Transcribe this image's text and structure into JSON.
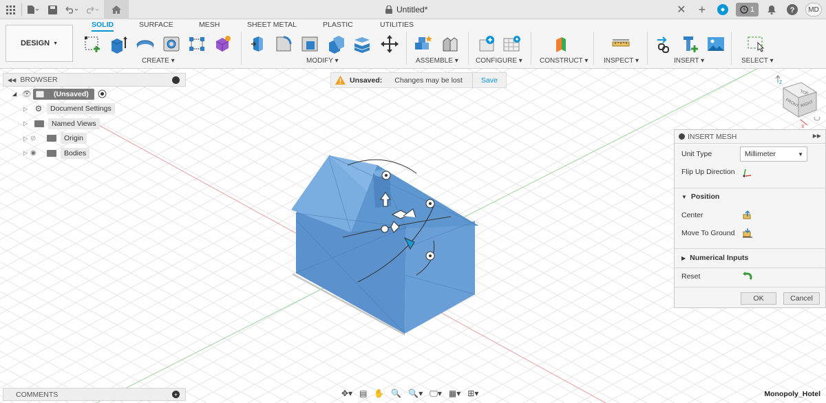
{
  "titlebar": {
    "doc_title": "Untitled*",
    "jobs_count": "1",
    "user_initials": "MD"
  },
  "toolbar": {
    "design_label": "DESIGN",
    "tabs": [
      "SOLID",
      "SURFACE",
      "MESH",
      "SHEET METAL",
      "PLASTIC",
      "UTILITIES"
    ],
    "active_tab": "SOLID",
    "groups": {
      "create": "CREATE",
      "modify": "MODIFY",
      "assemble": "ASSEMBLE",
      "configure": "CONFIGURE",
      "construct": "CONSTRUCT",
      "inspect": "INSPECT",
      "insert": "INSERT",
      "select": "SELECT"
    }
  },
  "browser": {
    "title": "BROWSER",
    "root_label": "(Unsaved)",
    "items": [
      "Document Settings",
      "Named Views",
      "Origin",
      "Bodies"
    ]
  },
  "banner": {
    "title": "Unsaved:",
    "message": "Changes may be lost",
    "save_label": "Save"
  },
  "dialog": {
    "title": "INSERT MESH",
    "unit_type_label": "Unit Type",
    "unit_type_value": "Millimeter",
    "flip_label": "Flip Up Direction",
    "position_section": "Position",
    "center_label": "Center",
    "move_ground_label": "Move To Ground",
    "numerical_section": "Numerical Inputs",
    "reset_label": "Reset",
    "ok_label": "OK",
    "cancel_label": "Cancel"
  },
  "viewcube": {
    "top": "TOP",
    "front": "FRONT",
    "right": "RIGHT"
  },
  "comments": {
    "title": "COMMENTS"
  },
  "status": {
    "model_name": "Monopoly_Hotel"
  },
  "colors": {
    "accent": "#0696d7",
    "model": "#5d93cc",
    "grid": "#e6e6e6"
  }
}
